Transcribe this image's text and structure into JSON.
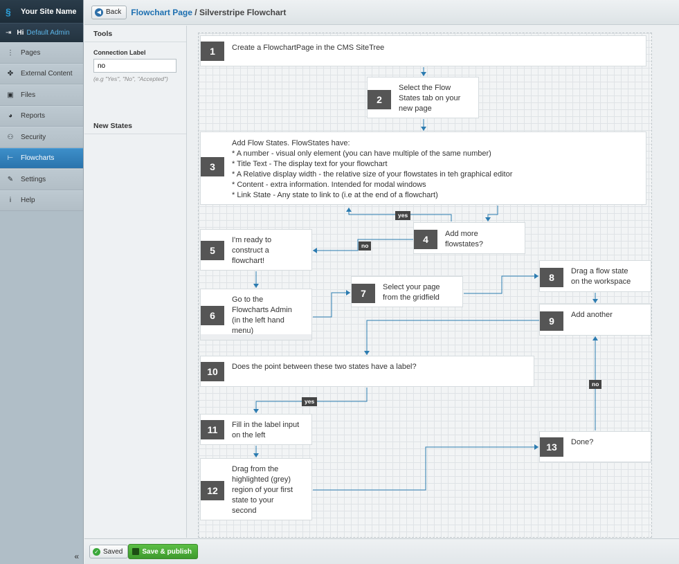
{
  "sidebar": {
    "site_name": "Your Site Name",
    "user_greeting": "Hi",
    "user_name": "Default Admin",
    "items": [
      {
        "label": "Pages",
        "icon": "sitemap-icon",
        "active": false
      },
      {
        "label": "External Content",
        "icon": "puzzle-icon",
        "active": false
      },
      {
        "label": "Files",
        "icon": "image-icon",
        "active": false
      },
      {
        "label": "Reports",
        "icon": "pie-chart-icon",
        "active": false
      },
      {
        "label": "Security",
        "icon": "users-icon",
        "active": false
      },
      {
        "label": "Flowcharts",
        "icon": "flowchart-icon",
        "active": true
      },
      {
        "label": "Settings",
        "icon": "wrench-icon",
        "active": false
      },
      {
        "label": "Help",
        "icon": "info-icon",
        "active": false
      }
    ],
    "collapse_glyph": "«"
  },
  "header": {
    "back_label": "Back",
    "breadcrumb_link": "Flowchart Page",
    "breadcrumb_sep": " / ",
    "breadcrumb_current": "Silverstripe Flowchart"
  },
  "tools": {
    "title": "Tools",
    "connection_label": "Connection Label",
    "connection_value": "no",
    "hint": "(e.g \"Yes\", \"No\", \"Accepted\")",
    "new_states_title": "New States"
  },
  "flowchart": {
    "states": [
      {
        "number": "1",
        "lines": [
          "Create a FlowchartPage in the CMS SiteTree"
        ]
      },
      {
        "number": "2",
        "lines": [
          "Select the Flow",
          "States tab on your",
          "new page"
        ]
      },
      {
        "number": "3",
        "lines": [
          "Add Flow States. FlowStates have:",
          "* A number - visual only element (you can have multiple of the same number)",
          "* Title Text - The display text for your flowchart",
          "* A Relative display width - the relative size of your flowstates in teh graphical editor",
          "* Content - extra information. Intended for modal windows",
          "* Link State - Any state to link to (i.e at the end of a flowchart)"
        ]
      },
      {
        "number": "4",
        "lines": [
          "Add more",
          "flowstates?"
        ]
      },
      {
        "number": "5",
        "lines": [
          "I'm ready to",
          "construct a",
          "flowchart!"
        ]
      },
      {
        "number": "6",
        "lines": [
          "Go to the",
          "Flowcharts Admin",
          "(in the left hand",
          "menu)"
        ]
      },
      {
        "number": "7",
        "lines": [
          "Select your page",
          "from the gridfield"
        ]
      },
      {
        "number": "8",
        "lines": [
          "Drag a flow state",
          "on the workspace"
        ]
      },
      {
        "number": "9",
        "lines": [
          "Add another"
        ]
      },
      {
        "number": "10",
        "lines": [
          "Does the point between these two states have a label?"
        ]
      },
      {
        "number": "11",
        "lines": [
          "Fill in the label input",
          "on the left"
        ]
      },
      {
        "number": "12",
        "lines": [
          "Drag from the",
          "highlighted (grey)",
          "region of your first",
          "state to your",
          "second"
        ]
      },
      {
        "number": "13",
        "lines": [
          "Done?"
        ]
      }
    ],
    "labels": [
      "yes",
      "no",
      "yes",
      "no"
    ],
    "wire_color": "#2b7bb0"
  },
  "footer": {
    "saved_label": "Saved",
    "publish_label": "Save & publish"
  }
}
